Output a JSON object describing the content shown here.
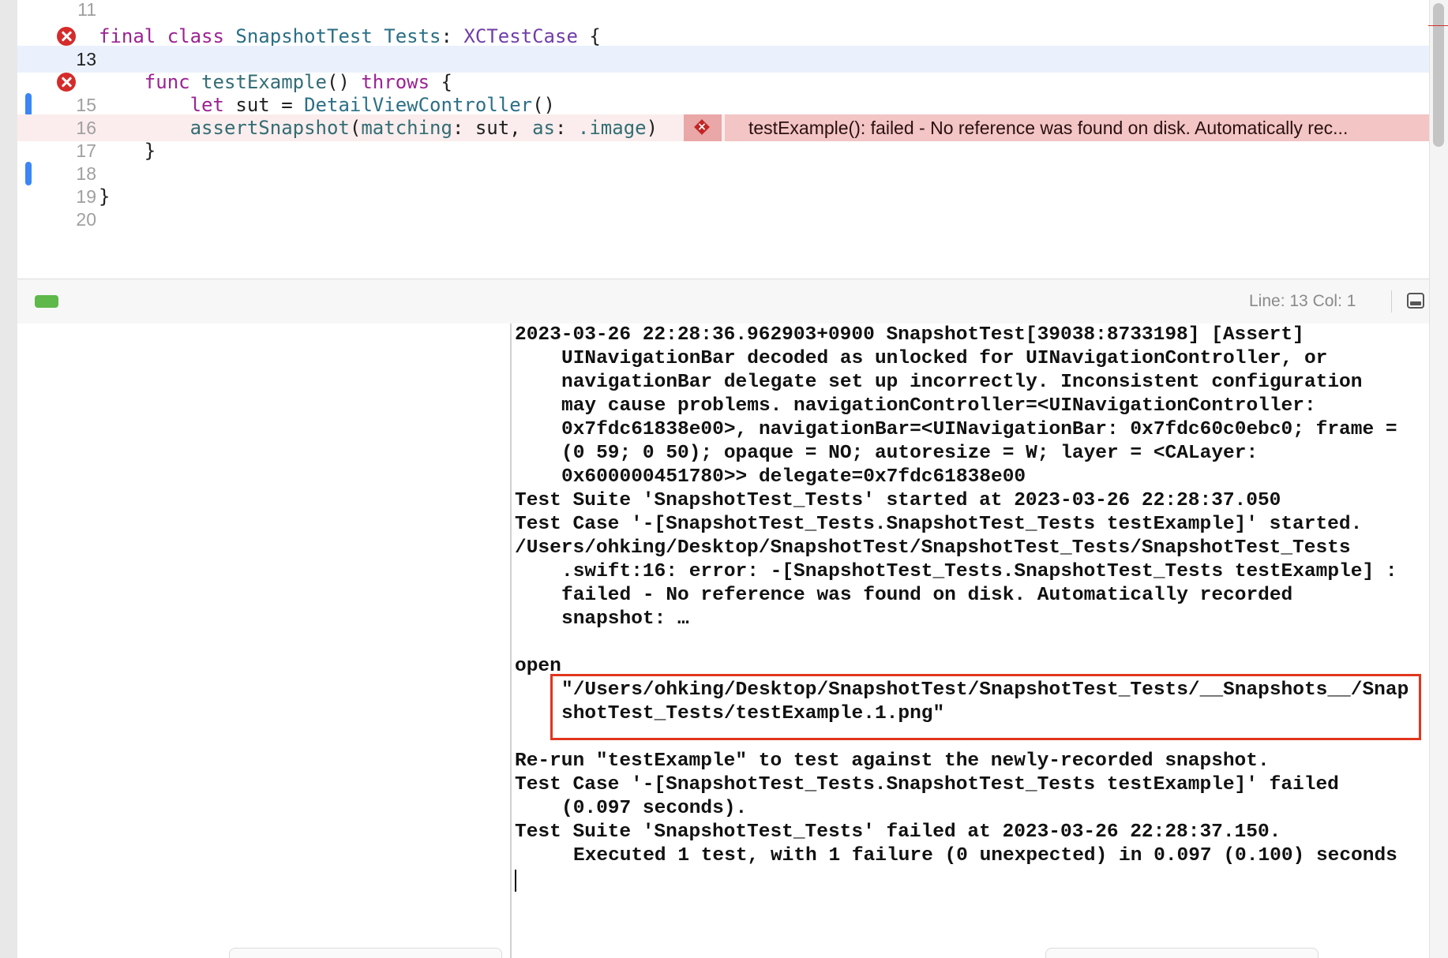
{
  "editor": {
    "lines": [
      {
        "number": "11",
        "has_error_icon": false,
        "change_marker": false,
        "current": false,
        "error_line": false
      },
      {
        "number": "",
        "has_error_icon": true,
        "change_marker": false,
        "current": false,
        "error_line": false,
        "code": {
          "kw_final": "final",
          "kw_class": "class",
          "class_name": "SnapshotTest_Tests",
          "colon": ": ",
          "super_type": "XCTestCase",
          "brace": " {"
        }
      },
      {
        "number": "13",
        "has_error_icon": false,
        "change_marker": false,
        "current": true,
        "error_line": false
      },
      {
        "number": "",
        "has_error_icon": true,
        "change_marker": false,
        "current": false,
        "error_line": false,
        "code": {
          "indent": "    ",
          "kw_func": "func",
          "fn_name": "testExample",
          "parens": "() ",
          "kw_throws": "throws",
          "brace": " {"
        }
      },
      {
        "number": "15",
        "has_error_icon": false,
        "change_marker": true,
        "current": false,
        "error_line": false,
        "code": {
          "indent": "        ",
          "kw_let": "let",
          "rest": " sut = ",
          "type_name": "DetailViewController",
          "call": "()"
        }
      },
      {
        "number": "16",
        "has_error_icon": false,
        "change_marker": false,
        "current": false,
        "error_line": true,
        "code": {
          "indent": "        ",
          "fn_name": "assertSnapshot",
          "open": "(",
          "label1": "matching",
          "mid1": ": sut, ",
          "label2": "as",
          "mid2": ": ",
          "member": ".image",
          "close": ")"
        }
      },
      {
        "number": "17",
        "has_error_icon": false,
        "change_marker": false,
        "current": false,
        "error_line": false,
        "code": {
          "text": "    }"
        }
      },
      {
        "number": "18",
        "has_error_icon": false,
        "change_marker": true,
        "current": false,
        "error_line": false
      },
      {
        "number": "19",
        "has_error_icon": false,
        "change_marker": false,
        "current": false,
        "error_line": false,
        "code": {
          "text": "}"
        }
      },
      {
        "number": "20",
        "has_error_icon": false,
        "change_marker": false,
        "current": false,
        "error_line": false
      }
    ],
    "error_badge": {
      "message": "testExample(): failed - No reference was found on disk. Automatically rec..."
    }
  },
  "debug_bar": {
    "line_col": "Line: 13  Col: 1"
  },
  "console": {
    "lines": [
      {
        "text": "2023-03-26 22:28:36.962903+0900 SnapshotTest[39038:8733198] [Assert]",
        "indent": 0
      },
      {
        "text": "UINavigationBar decoded as unlocked for UINavigationController, or",
        "indent": 1
      },
      {
        "text": "navigationBar delegate set up incorrectly. Inconsistent configuration",
        "indent": 1
      },
      {
        "text": "may cause problems. navigationController=<UINavigationController:",
        "indent": 1
      },
      {
        "text": "0x7fdc61838e00>, navigationBar=<UINavigationBar: 0x7fdc60c0ebc0; frame =",
        "indent": 1
      },
      {
        "text": "(0 59; 0 50); opaque = NO; autoresize = W; layer = <CALayer:",
        "indent": 1
      },
      {
        "text": "0x600000451780>> delegate=0x7fdc61838e00",
        "indent": 1
      },
      {
        "text": "Test Suite 'SnapshotTest_Tests' started at 2023-03-26 22:28:37.050",
        "indent": 0
      },
      {
        "text": "Test Case '-[SnapshotTest_Tests.SnapshotTest_Tests testExample]' started.",
        "indent": 0
      },
      {
        "text": "/Users/ohking/Desktop/SnapshotTest/SnapshotTest_Tests/SnapshotTest_Tests",
        "indent": 0
      },
      {
        "text": ".swift:16: error: -[SnapshotTest_Tests.SnapshotTest_Tests testExample] :",
        "indent": 1
      },
      {
        "text": "failed - No reference was found on disk. Automatically recorded",
        "indent": 1
      },
      {
        "text": "snapshot: …",
        "indent": 1
      },
      {
        "text": "",
        "indent": 0
      },
      {
        "text": "open",
        "indent": 0
      },
      {
        "text": "\"/Users/ohking/Desktop/SnapshotTest/SnapshotTest_Tests/__Snapshots__/Snap",
        "indent": 1
      },
      {
        "text": "shotTest_Tests/testExample.1.png\"",
        "indent": 1
      },
      {
        "text": "",
        "indent": 0
      },
      {
        "text": "Re-run \"testExample\" to test against the newly-recorded snapshot.",
        "indent": 0
      },
      {
        "text": "Test Case '-[SnapshotTest_Tests.SnapshotTest_Tests testExample]' failed",
        "indent": 0
      },
      {
        "text": "(0.097 seconds).",
        "indent": 1
      },
      {
        "text": "Test Suite 'SnapshotTest_Tests' failed at 2023-03-26 22:28:37.150.",
        "indent": 0
      },
      {
        "text": "Executed 1 test, with 1 failure (0 unexpected) in 0.097 (0.100) seconds",
        "indent": 2
      }
    ]
  },
  "colors": {
    "keyword": "#9b2393",
    "type": "#2b6f86",
    "error": "#d52b2b",
    "highlight_box": "#e0361e",
    "change_marker": "#3a86f5",
    "status_green": "#5fb84a"
  }
}
